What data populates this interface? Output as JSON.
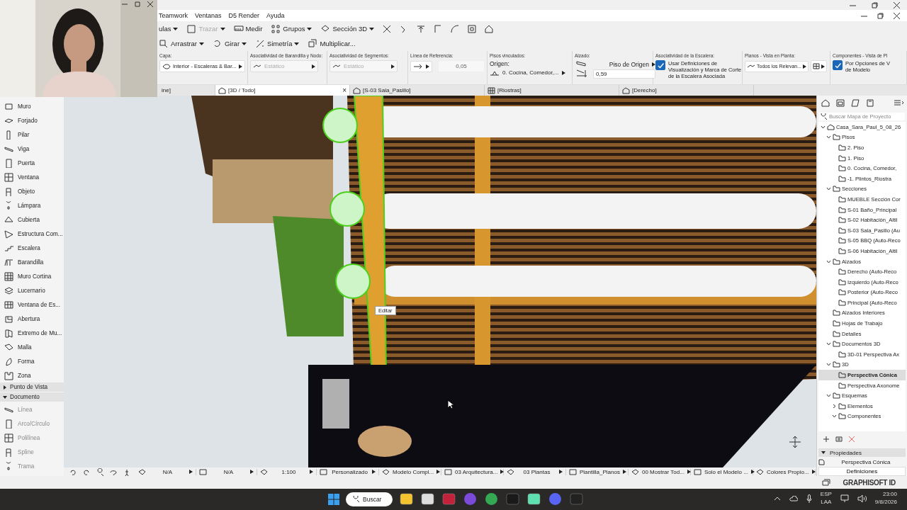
{
  "menu": [
    "Teamwork",
    "Ventanas",
    "D5 Render",
    "Ayuda"
  ],
  "toolbar_1": [
    {
      "label": "ulas",
      "dropdown": true,
      "disabled": false
    },
    {
      "label": "Trazar",
      "dropdown": true,
      "disabled": true
    },
    {
      "label": "Medir",
      "dropdown": false,
      "disabled": false
    },
    {
      "label": "Grupos",
      "dropdown": true,
      "disabled": false
    },
    {
      "label": "Sección 3D",
      "dropdown": true,
      "disabled": false
    }
  ],
  "toolbar_2": [
    {
      "label": "Arrastrar",
      "dropdown": true,
      "disabled": false
    },
    {
      "label": "Girar",
      "dropdown": true,
      "disabled": false
    },
    {
      "label": "Simetría",
      "dropdown": true,
      "disabled": false
    },
    {
      "label": "Multiplicar...",
      "dropdown": false,
      "disabled": false
    }
  ],
  "info_box": [
    {
      "label": "Capa:",
      "kind": "popup",
      "value": "Interior - Escaleras & Bar...",
      "disabled": false
    },
    {
      "label": "Asociatividad de Barandilla y Nodo:",
      "kind": "popup",
      "value": "Estático",
      "disabled": true
    },
    {
      "label": "Asociatividad de Segmentos:",
      "kind": "popup",
      "value": "Estático",
      "disabled": true
    },
    {
      "label": "Línea de Referencia:",
      "kind": "number",
      "value": "0,05"
    },
    {
      "label": "Pisos vinculados:",
      "kind": "story",
      "caption": "Origen:",
      "value": "0. Cocina, Comedor,..."
    },
    {
      "label": "Alzado:",
      "kind": "elevation",
      "caption": "Piso de Origen",
      "value": "0,59"
    },
    {
      "label": "Asociatividad de la Escalera:",
      "kind": "checkbox",
      "checked": true,
      "lines": [
        "Usar Definiciones de",
        "Visualización y Marca de Corte",
        "de la Escalera Asociada"
      ]
    },
    {
      "label": "Planos - Vista en Planta:",
      "kind": "popup",
      "value": "Todos los Relevan...",
      "disabled": false
    },
    {
      "label": "Componentes - Vista de Pl",
      "kind": "checkbox",
      "checked": true,
      "lines": [
        "Por Opciones de V",
        "de Modelo"
      ]
    }
  ],
  "tabs": [
    {
      "label": "ine]",
      "selected": false
    },
    {
      "label": "[3D / Todo]",
      "selected": true,
      "close": "×"
    },
    {
      "label": "[S-03 Sala_Pasillo]",
      "selected": false
    },
    {
      "label": "[Riostras]",
      "selected": false
    },
    {
      "label": "[Derecho]",
      "selected": false
    }
  ],
  "toolbox": {
    "tools": [
      {
        "label": "Muro",
        "disabled": false
      },
      {
        "label": "Forjado",
        "disabled": false
      },
      {
        "label": "Pilar",
        "disabled": false
      },
      {
        "label": "Viga",
        "disabled": false
      },
      {
        "label": "Puerta",
        "disabled": false
      },
      {
        "label": "Ventana",
        "disabled": false
      },
      {
        "label": "Objeto",
        "disabled": false
      },
      {
        "label": "Lámpara",
        "disabled": false
      },
      {
        "label": "Cubierta",
        "disabled": false
      },
      {
        "label": "Estructura Com...",
        "disabled": false
      },
      {
        "label": "Escalera",
        "disabled": false
      },
      {
        "label": "Barandilla",
        "disabled": false
      },
      {
        "label": "Muro Cortina",
        "disabled": false
      },
      {
        "label": "Lucernario",
        "disabled": false
      },
      {
        "label": "Ventana de Es...",
        "disabled": false
      },
      {
        "label": "Abertura",
        "disabled": false
      },
      {
        "label": "Extremo de Mu...",
        "disabled": false
      },
      {
        "label": "Malla",
        "disabled": false
      },
      {
        "label": "Forma",
        "disabled": false
      },
      {
        "label": "Zona",
        "disabled": false
      }
    ],
    "groups": [
      {
        "label": "Punto de Vista",
        "expanded": false
      },
      {
        "label": "Documento",
        "expanded": true,
        "tools": [
          {
            "label": "Línea",
            "disabled": true
          },
          {
            "label": "Arco/Círculo",
            "disabled": true
          },
          {
            "label": "Polilínea",
            "disabled": true
          },
          {
            "label": "Spline",
            "disabled": true
          },
          {
            "label": "Trama",
            "disabled": true
          }
        ]
      }
    ]
  },
  "viewport": {
    "tooltip": "Editar"
  },
  "navigator": {
    "search": {
      "placeholder": "Buscar Mapa de Proyecto"
    },
    "tree": [
      {
        "label": "Casa_Sara_Paul_5_08_26",
        "expanded": true,
        "selected": false,
        "children": [
          {
            "label": "Pisos",
            "expanded": true,
            "selected": false,
            "children": [
              {
                "label": "2. Piso",
                "selected": false
              },
              {
                "label": "1. Piso",
                "selected": false
              },
              {
                "label": "0. Cocina, Comedor,",
                "selected": false
              },
              {
                "label": "-1. Plintos_Riostra",
                "selected": false
              }
            ]
          },
          {
            "label": "Secciones",
            "expanded": true,
            "selected": false,
            "children": [
              {
                "label": "MUEBLE Sección Cor",
                "selected": false
              },
              {
                "label": "S-01 Baño_Principal",
                "selected": false
              },
              {
                "label": "S-02 Habitación_Altil",
                "selected": false
              },
              {
                "label": "S-03 Sala_Pasillo (Au",
                "selected": false
              },
              {
                "label": "S-05 BBQ (Auto-Reco",
                "selected": false
              },
              {
                "label": "S-06 Habitación_Altil",
                "selected": false
              }
            ]
          },
          {
            "label": "Alzados",
            "expanded": true,
            "selected": false,
            "children": [
              {
                "label": "Derecho (Auto-Reco",
                "selected": false
              },
              {
                "label": "Izquierdo (Auto-Reco",
                "selected": false
              },
              {
                "label": "Posterior (Auto-Reco",
                "selected": false
              },
              {
                "label": "Principal (Auto-Reco",
                "selected": false
              }
            ]
          },
          {
            "label": "Alzados Interiores",
            "selected": false
          },
          {
            "label": "Hojas de Trabajo",
            "selected": false
          },
          {
            "label": "Detalles",
            "selected": false
          },
          {
            "label": "Documentos 3D",
            "expanded": true,
            "selected": false,
            "children": [
              {
                "label": "3D-01 Perspectiva Ax",
                "selected": false
              }
            ]
          },
          {
            "label": "3D",
            "expanded": true,
            "selected": false,
            "children": [
              {
                "label": "Perspectiva Cónica",
                "selected": true
              },
              {
                "label": "Perspectiva Axonome",
                "selected": false
              }
            ]
          },
          {
            "label": "Esquemas",
            "expanded": true,
            "selected": false,
            "children": [
              {
                "label": "Elementos",
                "expanded": false,
                "selected": false
              },
              {
                "label": "Componentes",
                "expanded": true,
                "selected": false
              }
            ]
          }
        ]
      }
    ],
    "properties": {
      "title": "Propiedades",
      "expanded": true,
      "value": "Perspectiva Cónica",
      "button": "Definiciones"
    }
  },
  "status_bar": [
    "N/A",
    "N/A",
    "1:100",
    "Personalizado",
    "Modelo Compl...",
    "03 Arquitectura...",
    "03 Plantas",
    "Plantilla_Planos",
    "00 Mostrar Tod...",
    "Solo el Modelo ...",
    "Colores Propio..."
  ],
  "account": "GRAPHISOFT ID",
  "taskbar": {
    "search": "Buscar",
    "language": "ESP",
    "layout": "LAA",
    "time": "23:00",
    "date": "9/8/2026"
  }
}
